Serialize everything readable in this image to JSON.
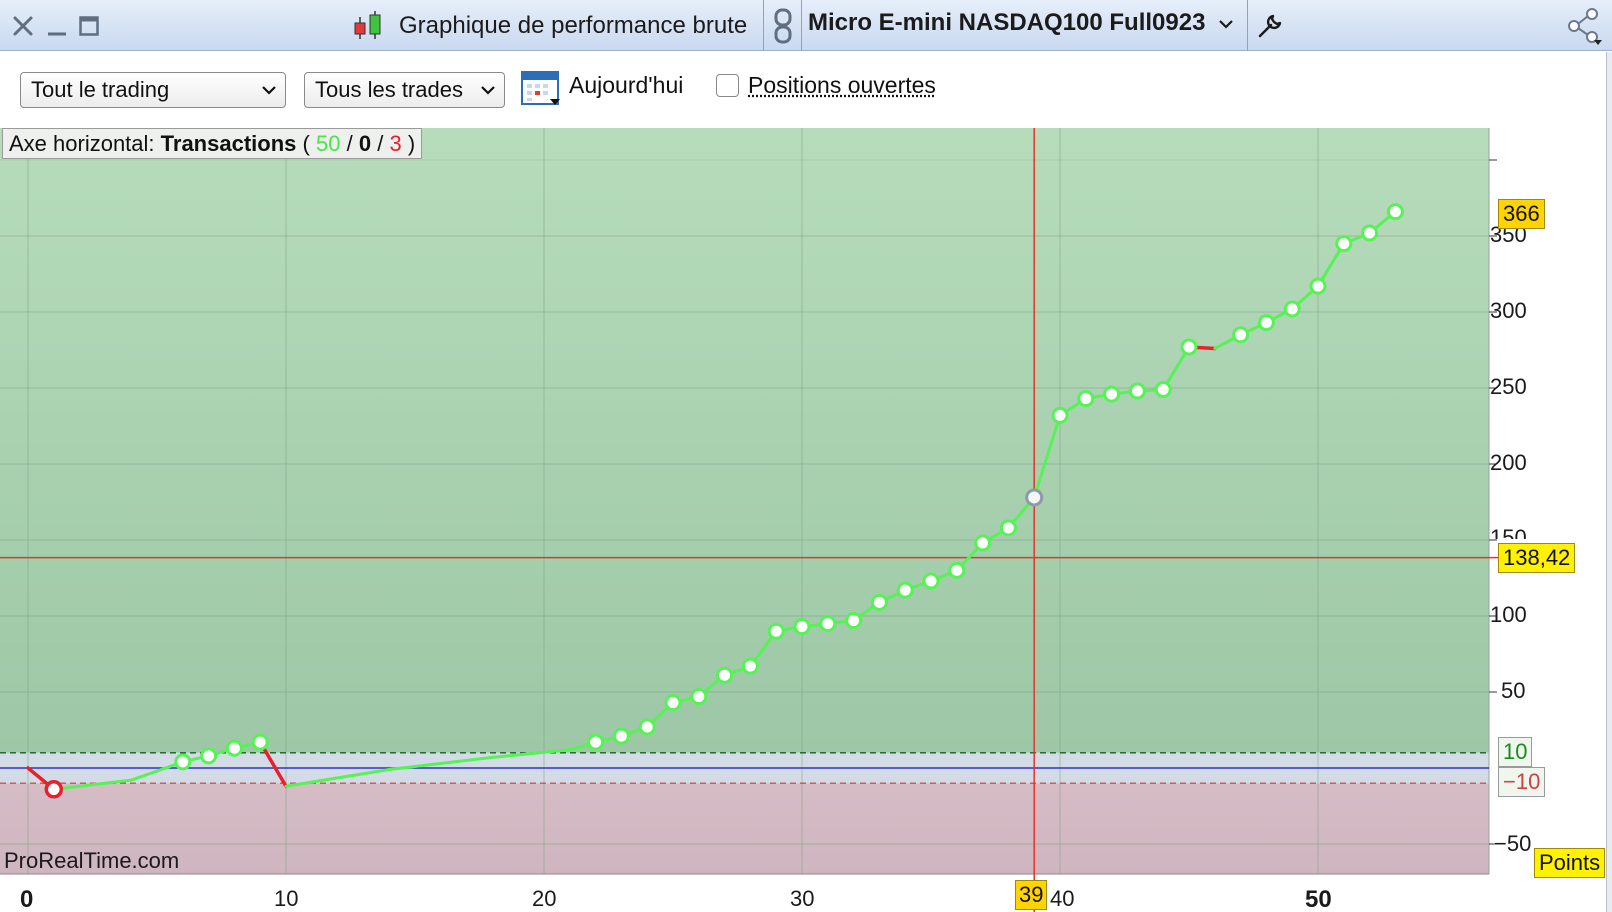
{
  "window": {
    "title": "Graphique de performance brute",
    "instrument": "Micro E-mini NASDAQ100 Full0923",
    "icons": [
      "close-icon",
      "minimize-icon",
      "maximize-icon",
      "candlestick-icon",
      "link-icon",
      "chevron-down-icon",
      "wrench-icon",
      "share-icon"
    ]
  },
  "toolbar": {
    "period_select": "Tout le trading",
    "trades_select": "Tous les trades",
    "today_label": "Aujourd'hui",
    "open_positions_label": "Positions ouvertes",
    "open_positions_checked": false,
    "calendar_icon": "calendar-icon"
  },
  "info": {
    "prefix": "Axe horizontal:",
    "mode": "Transactions",
    "open_paren": "(",
    "wins": "50",
    "slash": "/",
    "neutral": "0",
    "losses": "3",
    "close_paren": ")"
  },
  "watermark": "ProRealTime.com",
  "units": "Points",
  "markers": {
    "last_value": "366",
    "cursor_value": "138,42",
    "cursor_x": "39",
    "upper_band": "10",
    "lower_band": "−10"
  },
  "colors": {
    "profit_zone": "#9dc7a6",
    "loss_zone": "#cfb5bf",
    "equity_up": "#56f256",
    "equity_down": "#e8202c",
    "cursor": "#e8332a",
    "zero_line": "#3030d0"
  },
  "chart_data": {
    "type": "line",
    "xlabel": "",
    "ylabel": "Points",
    "x_ticks": [
      "0",
      "10",
      "20",
      "30",
      "40",
      "50"
    ],
    "y_ticks": [
      "−50",
      "50",
      "100",
      "150",
      "200",
      "250",
      "300",
      "350"
    ],
    "xlim": [
      0,
      56
    ],
    "ylim": [
      -58,
      385
    ],
    "series": [
      {
        "x": [
          0,
          1,
          4,
          6,
          7,
          8,
          9,
          10,
          14,
          18,
          21,
          22,
          23,
          24,
          25,
          26,
          27,
          28,
          29,
          30,
          31,
          32,
          33,
          34,
          35,
          36,
          37,
          38,
          39,
          40,
          41,
          42,
          43,
          44,
          45,
          46,
          47,
          48,
          49,
          50,
          51,
          52,
          53
        ],
        "y": [
          0,
          -14,
          -8,
          4,
          8,
          13,
          17,
          -12,
          -1,
          7,
          12,
          17,
          21,
          27,
          43,
          47,
          61,
          67,
          90,
          93,
          95,
          97,
          109,
          117,
          123,
          130,
          148,
          158,
          178,
          232,
          243,
          246,
          248,
          249,
          277,
          276,
          285,
          293,
          302,
          317,
          345,
          352,
          366
        ]
      }
    ],
    "losing_segments": [
      [
        0,
        1
      ],
      [
        9,
        10
      ],
      [
        45,
        46
      ]
    ],
    "no_marker_x": [
      0,
      4,
      10,
      14,
      18,
      21,
      46
    ],
    "highlighted_x": 39,
    "cursor_y": 138.42,
    "band": [
      -10,
      10
    ],
    "grid": true
  }
}
